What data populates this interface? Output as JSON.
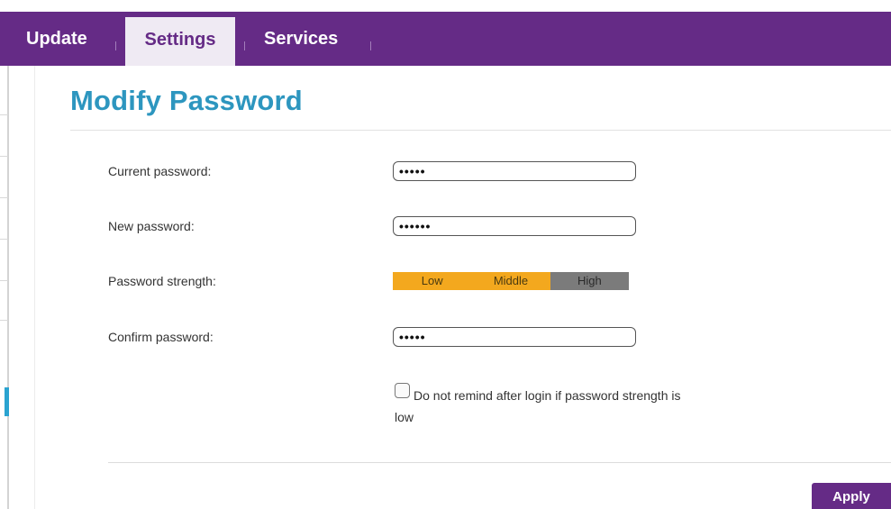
{
  "nav": {
    "tabs": [
      {
        "label": "Update",
        "active": false
      },
      {
        "label": "Settings",
        "active": true
      },
      {
        "label": "Services",
        "active": false
      }
    ]
  },
  "page": {
    "title": "Modify Password"
  },
  "form": {
    "current_password": {
      "label": "Current password:",
      "value": "•••••"
    },
    "new_password": {
      "label": "New password:",
      "value": "••••••"
    },
    "strength": {
      "label": "Password strength:",
      "levels": [
        "Low",
        "Middle",
        "High"
      ],
      "current": "Middle"
    },
    "confirm_password": {
      "label": "Confirm password:",
      "value": "•••••"
    },
    "remind_checkbox": {
      "label": "Do not remind after login if password strength is low",
      "checked": false
    },
    "apply_label": "Apply"
  },
  "colors": {
    "nav_bar": "#652b86",
    "title": "#2d96bf",
    "strength_filled": "#f3a81e",
    "strength_empty": "#7b7b7b",
    "sidebar_active": "#2aa3d0"
  }
}
